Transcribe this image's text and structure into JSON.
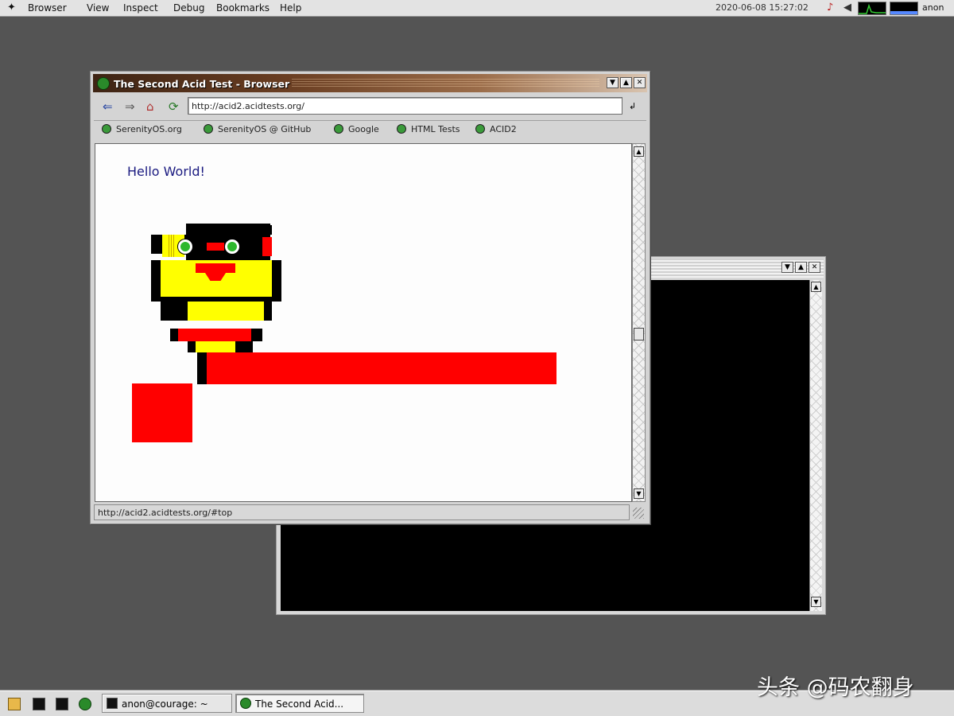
{
  "menubar": {
    "items": [
      "Browser",
      "View",
      "Inspect",
      "Debug",
      "Bookmarks",
      "Help"
    ],
    "clock": "2020-06-08 15:27:02",
    "user": "anon"
  },
  "browser": {
    "title": "The Second Acid Test - Browser",
    "url": "http://acid2.acidtests.org/",
    "bookmarks": [
      "SerenityOS.org",
      "SerenityOS @ GitHub",
      "Google",
      "HTML Tests",
      "ACID2"
    ],
    "status": "http://acid2.acidtests.org/#top",
    "page_text": "Hello World!"
  },
  "taskbar": {
    "tasks": [
      "anon@courage: ~",
      "The Second Acid..."
    ]
  },
  "watermark": "头条 @码农翻身",
  "colors": {
    "face_yellow": "#ffff00",
    "face_red": "#ff0000",
    "desktop": "#545454"
  },
  "icons": {
    "menu": "serenity-logo-icon",
    "back": "back-arrow-icon",
    "forward": "forward-arrow-icon",
    "home": "home-icon",
    "reload": "reload-icon"
  }
}
